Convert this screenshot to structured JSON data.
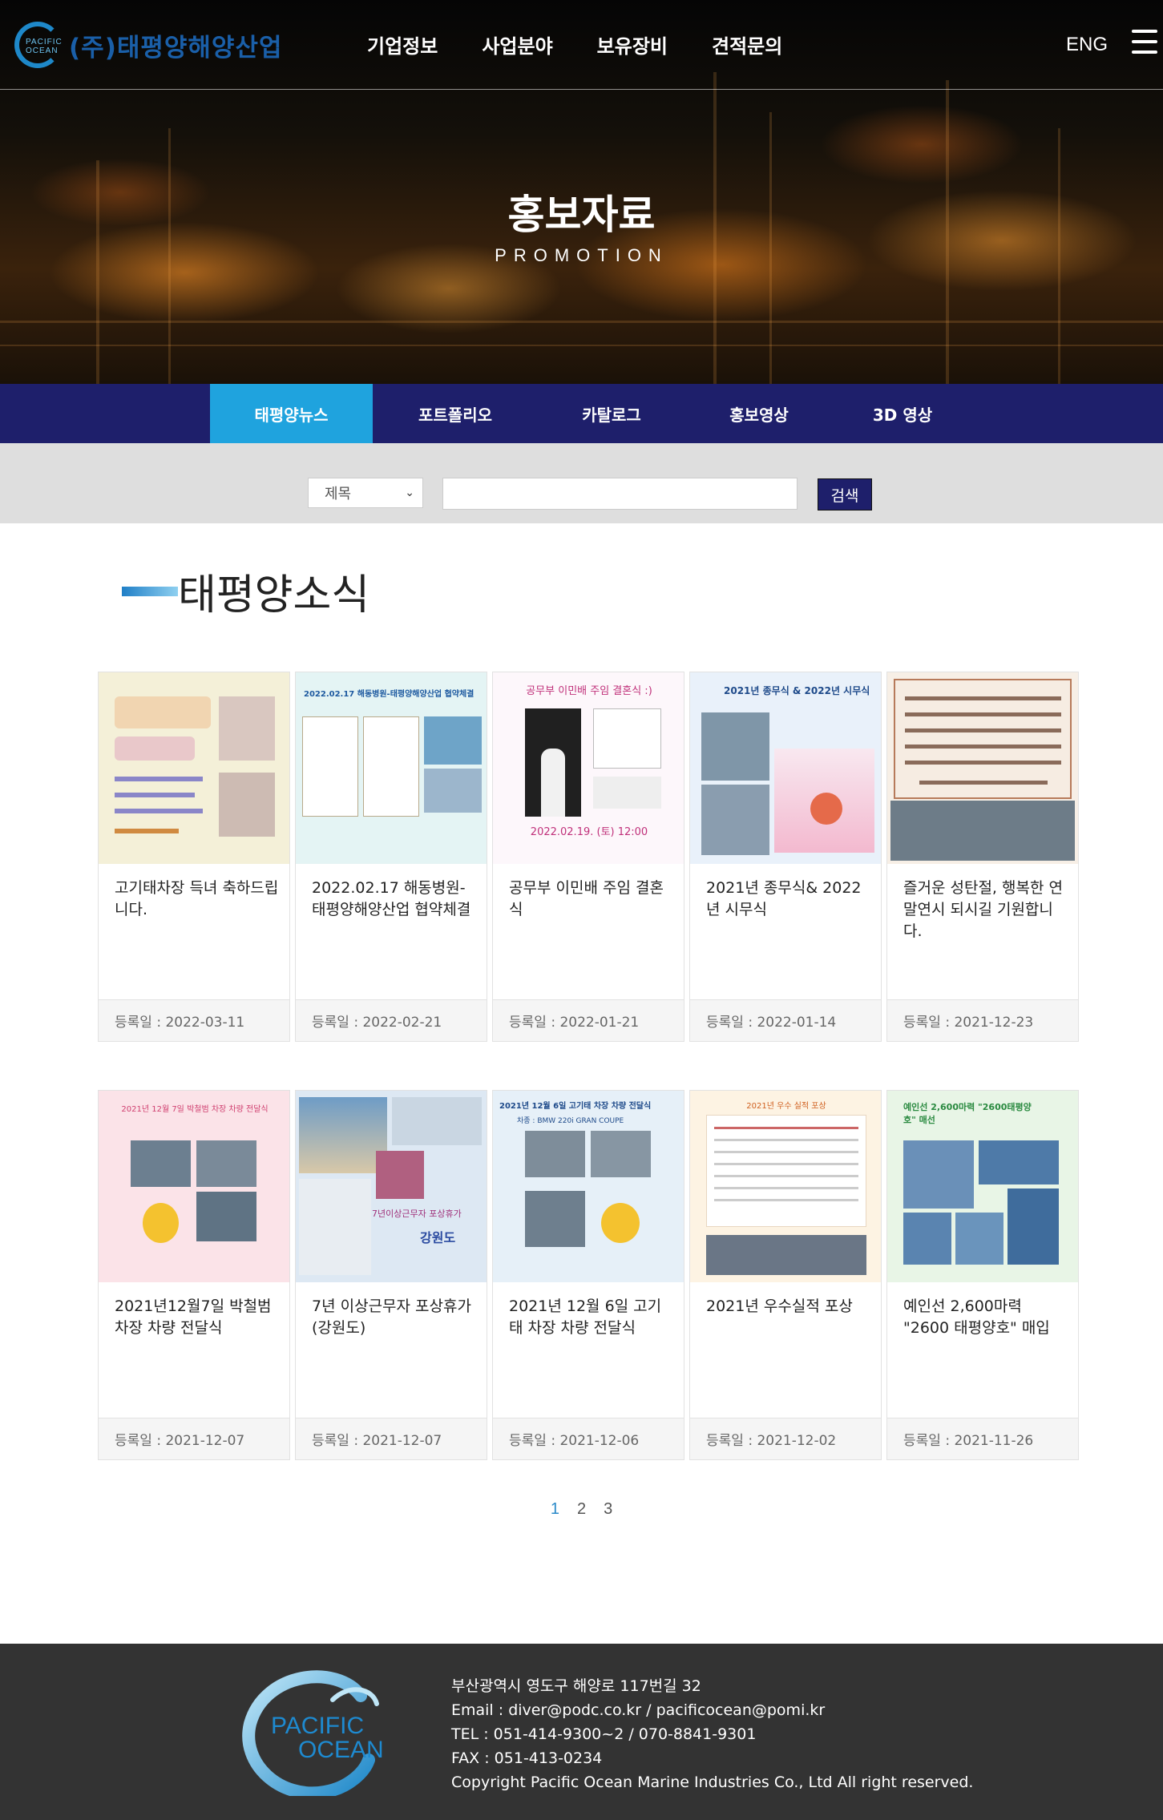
{
  "header": {
    "logo_mark": "PACIFIC OCEAN",
    "logo_text": "(주)태평양해양산업",
    "nav": [
      "기업정보",
      "사업분야",
      "보유장비",
      "견적문의"
    ],
    "lang": "ENG"
  },
  "banner": {
    "title": "홍보자료",
    "subtitle": "PROMOTION"
  },
  "tabs": [
    {
      "label": "태평양뉴스",
      "active": true
    },
    {
      "label": "포트폴리오",
      "active": false
    },
    {
      "label": "카탈로그",
      "active": false
    },
    {
      "label": "홍보영상",
      "active": false
    },
    {
      "label": "3D 영상",
      "active": false
    }
  ],
  "search": {
    "select_value": "제목",
    "input_value": "",
    "button_label": "검색"
  },
  "section": {
    "title": "태평양소식"
  },
  "posts": [
    {
      "title": "고기태차장 득녀 축하드립니다.",
      "date": "등록일 : 2022-03-11"
    },
    {
      "title": "2022.02.17 해동병원-태평양해양산업 협약체결",
      "date": "등록일 : 2022-02-21"
    },
    {
      "title": "공무부 이민배 주임 결혼식",
      "date": "등록일 : 2022-01-21"
    },
    {
      "title": "2021년 종무식& 2022년 시무식",
      "date": "등록일 : 2022-01-14"
    },
    {
      "title": "즐거운 성탄절, 행복한 연말연시 되시길 기원합니다.",
      "date": "등록일 : 2021-12-23"
    },
    {
      "title": "2021년12월7일 박철범 차장 차량 전달식",
      "date": "등록일 : 2021-12-07"
    },
    {
      "title": "7년 이상근무자 포상휴가(강원도)",
      "date": "등록일 : 2021-12-07"
    },
    {
      "title": "2021년 12월 6일 고기태 차장 차량 전달식",
      "date": "등록일 : 2021-12-06"
    },
    {
      "title": "2021년 우수실적 포상",
      "date": "등록일 : 2021-12-02"
    },
    {
      "title": "예인선 2,600마력 \"2600 태평양호\" 매입",
      "date": "등록일 : 2021-11-26"
    }
  ],
  "thumbs": {
    "t2_head": "2022.02.17 해동병원-태평양해양산업 협약체결",
    "t3_head": "공무부 이민배 주임 결혼식 :)",
    "t3_foot": "2022.02.19. (토) 12:00",
    "t4_head": "2021년 종무식 & 2022년 시무식",
    "t6_head": "2021년 12월 7일 박철범 차장 차량 전달식",
    "t7_head": "7년이상근무자 포상휴가",
    "t7_place": "강원도",
    "t8_head": "2021년 12월 6일 고기태 차장 차량 전달식",
    "t8_sub": "차종 : BMW 220i GRAN COUPE",
    "t9_head": "2021년 우수 실적 포상",
    "t10_head": "예인선 2,600마력 \"2600태평양호\" 매선"
  },
  "pagination": {
    "pages": [
      "1",
      "2",
      "3"
    ],
    "current": "1"
  },
  "footer": {
    "logo_line1": "PACIFIC",
    "logo_line2": "OCEAN",
    "address": "부산광역시 영도구 해양로 117번길 32",
    "email": "Email : diver@podc.co.kr / pacificocean@pomi.kr",
    "tel": "TEL : 051-414-9300~2 / 070-8841-9301",
    "fax": "FAX : 051-413-0234",
    "copyright": "Copyright Pacific Ocean Marine Industries Co., Ltd All right reserved."
  },
  "colors": {
    "tabbar": "#1e1f6b",
    "tab_active": "#1fa3de",
    "footer": "#333333",
    "page_current": "#2a8ac9"
  }
}
